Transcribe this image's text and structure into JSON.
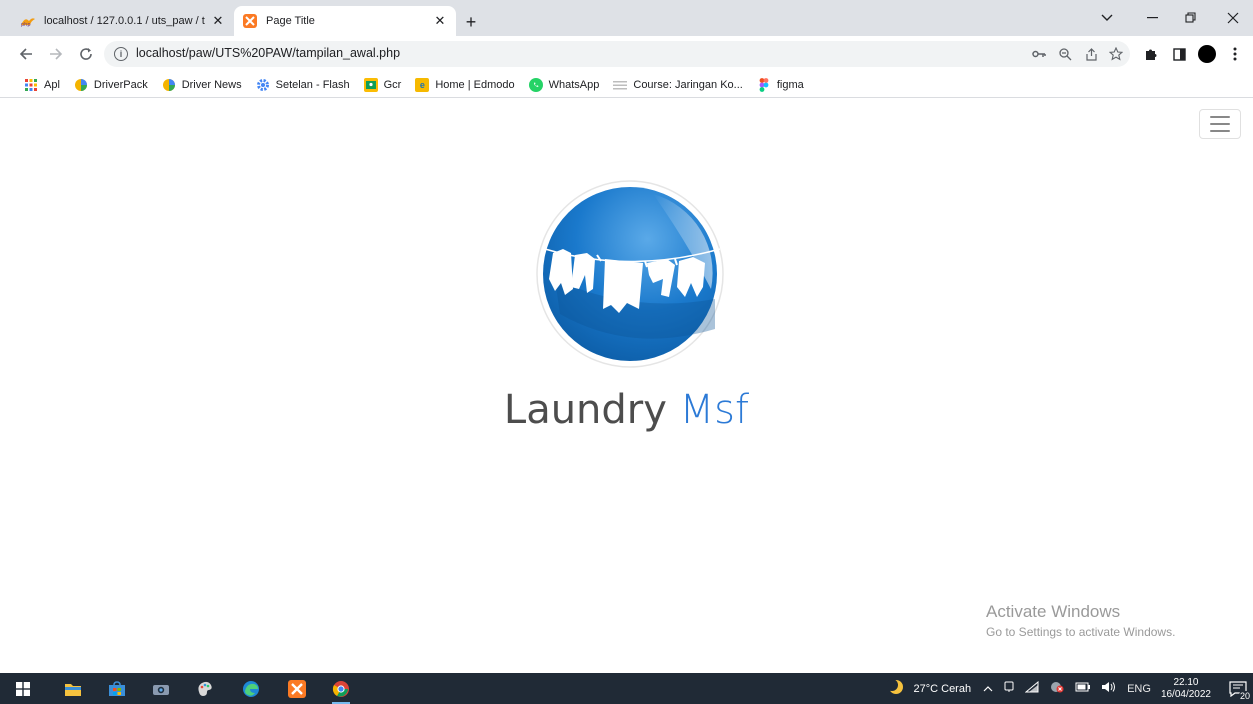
{
  "browser": {
    "tabs": [
      {
        "title": "localhost / 127.0.0.1 / uts_paw / t",
        "favicon": "phpmyadmin-icon",
        "active": false
      },
      {
        "title": "Page Title",
        "favicon": "xampp-icon",
        "active": true
      }
    ],
    "new_tab_label": "+",
    "url": "localhost/paw/UTS%20PAW/tampilan_awal.php",
    "bookmarks": [
      {
        "label": "Apl",
        "icon": "apps-grid-icon",
        "color": "#e8453c"
      },
      {
        "label": "DriverPack",
        "icon": "driverpack-icon",
        "color": "#f4b400"
      },
      {
        "label": "Driver News",
        "icon": "driverpack-icon",
        "color": "#f4b400"
      },
      {
        "label": "Setelan - Flash",
        "icon": "gear-icon",
        "color": "#4285f4"
      },
      {
        "label": "Gcr",
        "icon": "classroom-icon",
        "color": "#0f9d58"
      },
      {
        "label": "Home | Edmodo",
        "icon": "edmodo-icon",
        "color": "#f6b900"
      },
      {
        "label": "WhatsApp",
        "icon": "whatsapp-icon",
        "color": "#25d366"
      },
      {
        "label": "Course: Jaringan Ko...",
        "icon": "course-icon",
        "color": "#bdbdbd"
      },
      {
        "label": "figma",
        "icon": "figma-icon",
        "color": "#f24e1e"
      }
    ]
  },
  "page": {
    "brand_part1": "Laundry",
    "brand_part2": "Msf",
    "brand_color": "#2c7ad6"
  },
  "watermark": {
    "line1": "Activate Windows",
    "line2": "Go to Settings to activate Windows."
  },
  "taskbar": {
    "weather": "27°C  Cerah",
    "lang": "ENG",
    "time": "22.10",
    "date": "16/04/2022",
    "notifications": "20"
  }
}
